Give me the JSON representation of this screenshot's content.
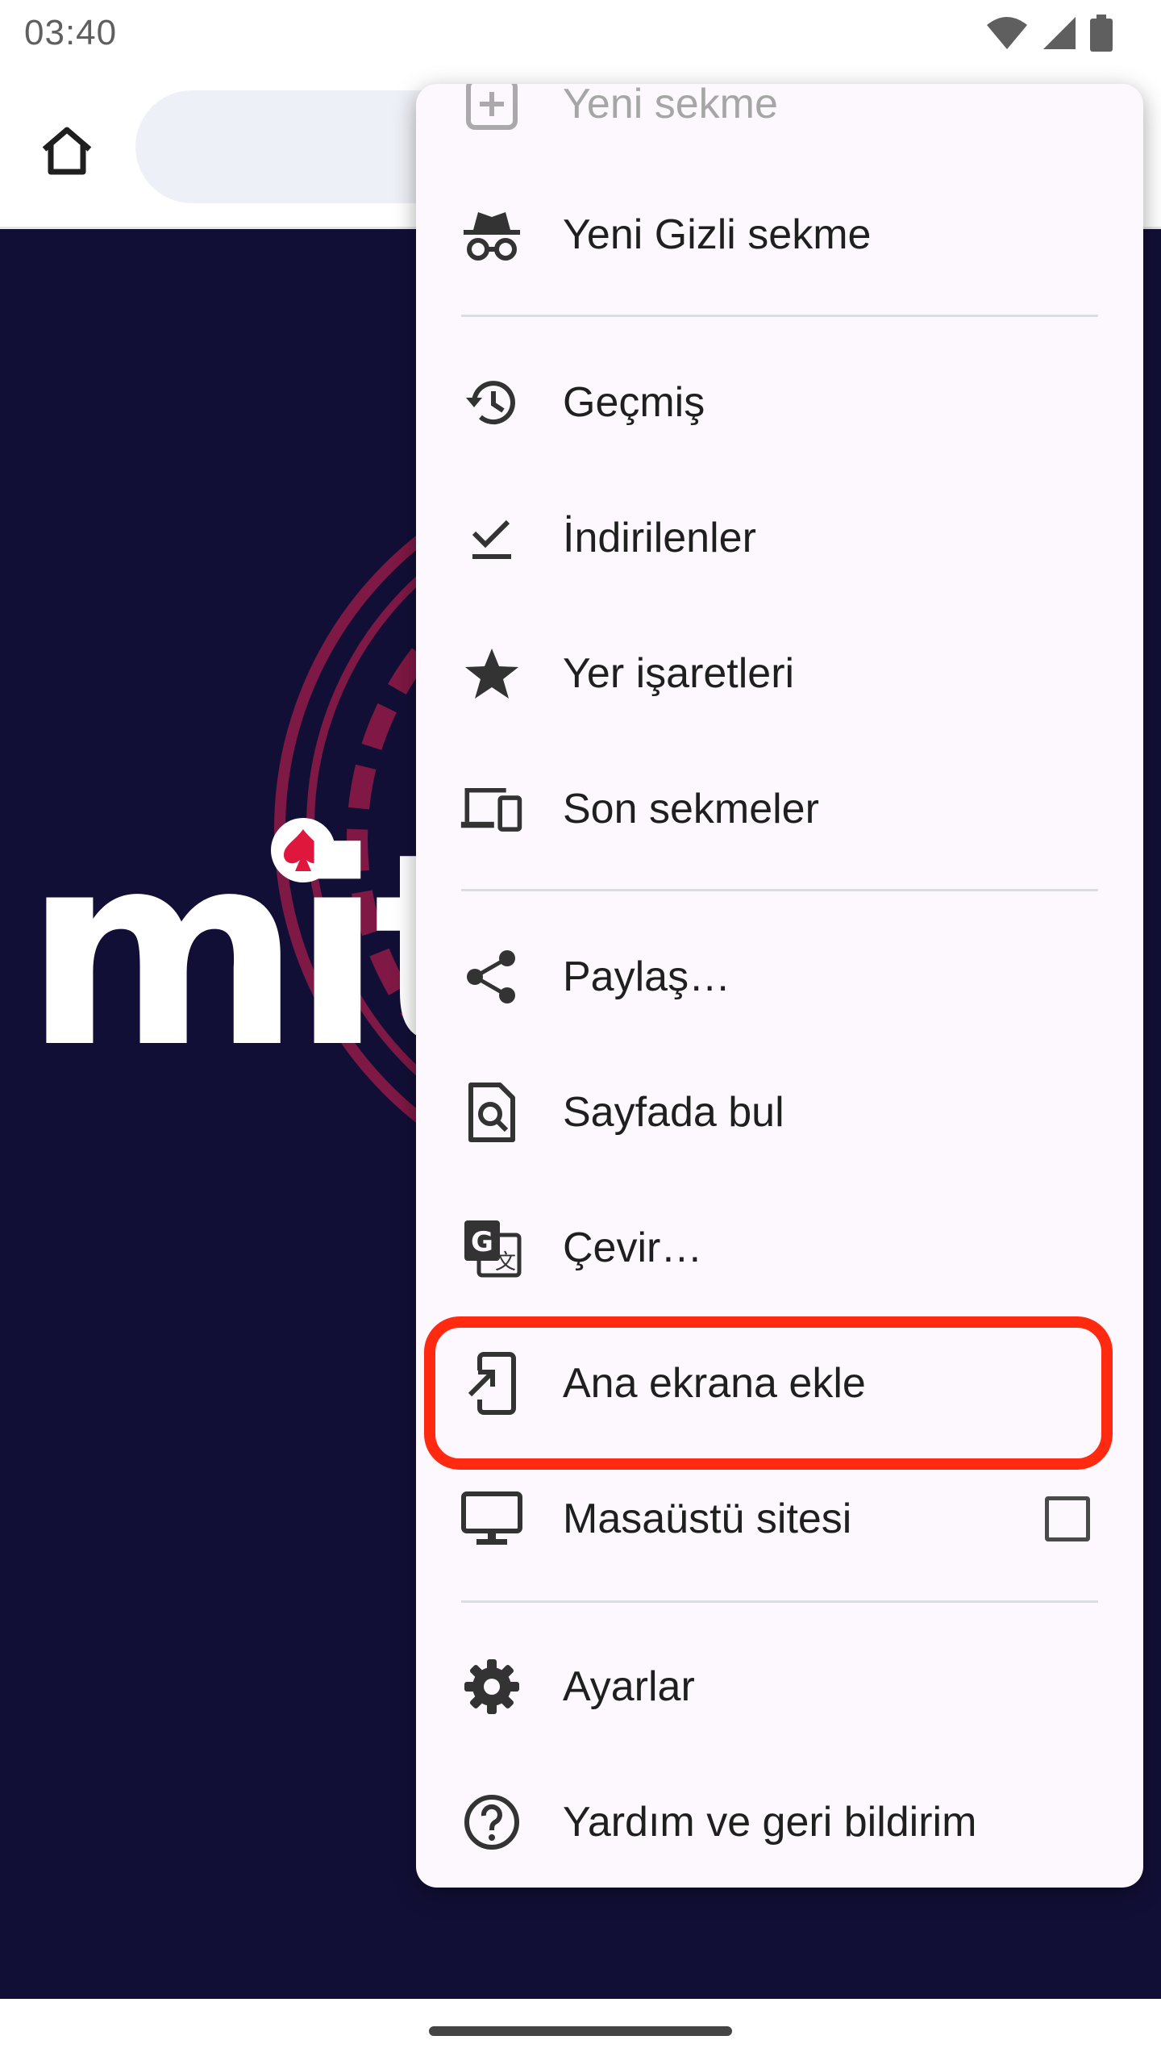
{
  "status_bar": {
    "time": "03:40",
    "icons": [
      "wifi-icon",
      "signal-icon",
      "battery-icon"
    ]
  },
  "toolbar": {
    "home_icon": "home-icon"
  },
  "page": {
    "logo_text": "mit",
    "background_color": "#120f36",
    "accent_color": "#8b1a46"
  },
  "menu": {
    "items": [
      {
        "label": "Yeni sekme",
        "icon": "new-tab-icon"
      },
      {
        "label": "Yeni Gizli sekme",
        "icon": "incognito-icon"
      },
      {
        "label": "Geçmiş",
        "icon": "history-icon"
      },
      {
        "label": "İndirilenler",
        "icon": "download-check-icon"
      },
      {
        "label": "Yer işaretleri",
        "icon": "star-icon"
      },
      {
        "label": "Son sekmeler",
        "icon": "devices-icon"
      },
      {
        "label": "Paylaş…",
        "icon": "share-icon"
      },
      {
        "label": "Sayfada bul",
        "icon": "find-in-page-icon"
      },
      {
        "label": "Çevir…",
        "icon": "translate-icon"
      },
      {
        "label": "Ana ekrana ekle",
        "icon": "add-to-home-icon"
      },
      {
        "label": "Masaüstü sitesi",
        "icon": "desktop-icon",
        "checked": false
      },
      {
        "label": "Ayarlar",
        "icon": "gear-icon"
      },
      {
        "label": "Yardım ve geri bildirim",
        "icon": "help-icon"
      }
    ]
  },
  "highlight_color": "#ff2a0f"
}
